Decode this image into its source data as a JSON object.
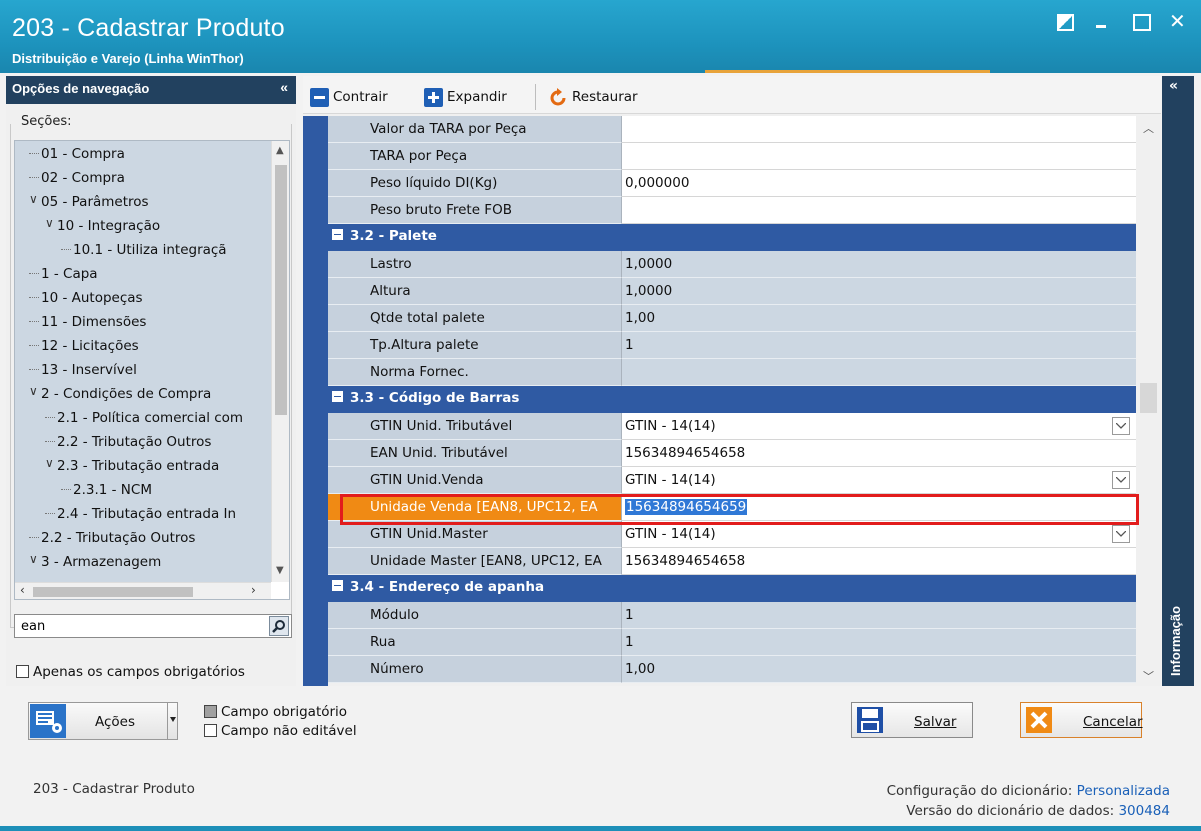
{
  "window": {
    "title": "203 - Cadastrar  Produto",
    "subtitle": "Distribuição e Varejo (Linha WinThor)",
    "controls": [
      "restore",
      "minimize",
      "maximize",
      "close"
    ]
  },
  "nav": {
    "header": "Opções de navegação",
    "collapse_glyph": "«",
    "sections_label": "Seções:",
    "items": [
      {
        "label": "01 - Compra",
        "level": 0
      },
      {
        "label": "02 - Compra",
        "level": 0
      },
      {
        "label": "05 - Parâmetros",
        "level": 0,
        "expanded": true
      },
      {
        "label": "10 - Integração",
        "level": 1,
        "expanded": true
      },
      {
        "label": "10.1 - Utiliza integraçã",
        "level": 2
      },
      {
        "label": "1 - Capa",
        "level": 0
      },
      {
        "label": "10 - Autopeças",
        "level": 0
      },
      {
        "label": "11 - Dimensões",
        "level": 0
      },
      {
        "label": "12 - Licitações",
        "level": 0
      },
      {
        "label": "13 - Inservível",
        "level": 0
      },
      {
        "label": "2 - Condições de Compra",
        "level": 0,
        "expanded": true
      },
      {
        "label": "2.1 - Política comercial com",
        "level": 1
      },
      {
        "label": "2.2 - Tributação Outros",
        "level": 1
      },
      {
        "label": "2.3 - Tributação entrada",
        "level": 1,
        "expanded": true
      },
      {
        "label": "2.3.1 - NCM",
        "level": 2
      },
      {
        "label": "2.4 - Tributação entrada In",
        "level": 1
      },
      {
        "label": "2.2 - Tributação Outros",
        "level": 0
      },
      {
        "label": "3 - Armazenagem",
        "level": 0,
        "expanded": true
      }
    ],
    "search_value": "ean",
    "required_only_label": "Apenas os campos obrigatórios"
  },
  "toolbar": {
    "collapse_label": "Contrair",
    "expand_label": "Expandir",
    "restore_label": "Restaurar"
  },
  "grid": {
    "rows": [
      {
        "type": "field",
        "label": "Valor da TARA por Peça",
        "value": "",
        "style": "white"
      },
      {
        "type": "field",
        "label": "TARA por Peça",
        "value": "",
        "style": "white"
      },
      {
        "type": "field",
        "label": "Peso líquido DI(Kg)",
        "value": "0,000000",
        "style": "white"
      },
      {
        "type": "field",
        "label": "Peso bruto Frete FOB",
        "value": "",
        "style": "white"
      },
      {
        "type": "category",
        "label": "3.2 - Palete"
      },
      {
        "type": "field",
        "label": "Lastro",
        "value": "1,0000",
        "style": "light"
      },
      {
        "type": "field",
        "label": "Altura",
        "value": "1,0000",
        "style": "light"
      },
      {
        "type": "field",
        "label": "Qtde total palete",
        "value": "1,00",
        "style": "light"
      },
      {
        "type": "field",
        "label": "Tp.Altura palete",
        "value": "1",
        "style": "light"
      },
      {
        "type": "field",
        "label": "Norma Fornec.",
        "value": "",
        "style": "light"
      },
      {
        "type": "category",
        "label": "3.3 - Código de Barras"
      },
      {
        "type": "field",
        "label": "GTIN Unid. Tributável",
        "value": "GTIN - 14(14)",
        "style": "white",
        "dropdown": true
      },
      {
        "type": "field",
        "label": "EAN Unid. Tributável",
        "value": "15634894654658",
        "style": "white"
      },
      {
        "type": "field",
        "label": "GTIN Unid.Venda",
        "value": "GTIN - 14(14)",
        "style": "white",
        "dropdown": true
      },
      {
        "type": "field",
        "label": "Unidade Venda [EAN8, UPC12, EA",
        "value": "15634894654659",
        "style": "white",
        "selected": true
      },
      {
        "type": "field",
        "label": "GTIN Unid.Master",
        "value": "GTIN - 14(14)",
        "style": "white",
        "dropdown": true
      },
      {
        "type": "field",
        "label": "Unidade Master [EAN8, UPC12, EA",
        "value": "15634894654658",
        "style": "white"
      },
      {
        "type": "category",
        "label": "3.4 - Endereço de apanha"
      },
      {
        "type": "field",
        "label": "Módulo",
        "value": "1",
        "style": "light"
      },
      {
        "type": "field",
        "label": "Rua",
        "value": "1",
        "style": "light"
      },
      {
        "type": "field",
        "label": "Número",
        "value": "1,00",
        "style": "light"
      }
    ]
  },
  "info_panel": {
    "label": "Informação",
    "collapse_glyph": "«"
  },
  "bottom": {
    "actions_label": "Ações",
    "legend_required": "Campo obrigatório",
    "legend_readonly": "Campo não editável",
    "save_label": "Salvar",
    "cancel_label": "Cancelar"
  },
  "footer": {
    "left": "203 - Cadastrar  Produto",
    "dict_config_label": "Configuração do dicionário:",
    "dict_config_value": "Personalizada",
    "dict_version_label": "Versão do dicionário de dados:",
    "dict_version_value": "300484"
  },
  "colors": {
    "title_bar": "#1d93bd",
    "nav_header": "#22415f",
    "category_row": "#2f5aa3",
    "selected_label": "#f08a14",
    "highlight_box": "#e21c1c"
  }
}
